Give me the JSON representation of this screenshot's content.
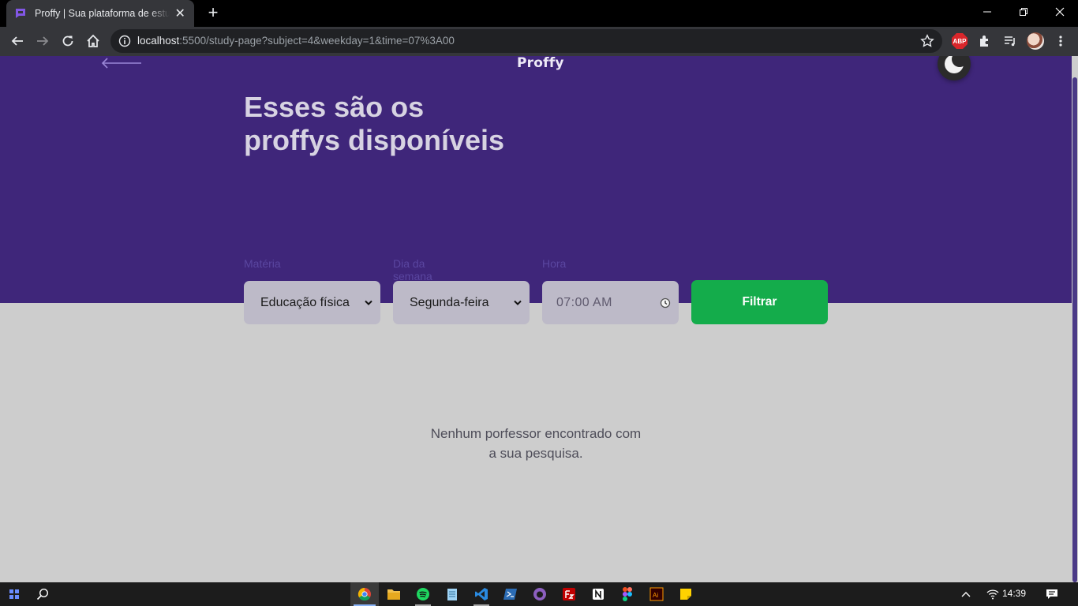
{
  "browser": {
    "tab_title": "Proffy | Sua plataforma de estudos online",
    "tab_close": "✕",
    "new_tab": "+",
    "url_host": "localhost",
    "url_rest": ":5500/study-page?subject=4&weekday=1&time=07%3A00",
    "extension_abp": "ABP"
  },
  "header": {
    "logo": "Proffy",
    "headline_line1": "Esses são os",
    "headline_line2": "proffys disponíveis"
  },
  "filters": {
    "subject_label": "Matéria",
    "subject_value": "Educação física",
    "weekday_label": "Dia da semana",
    "weekday_value": "Segunda-feira",
    "time_label": "Hora",
    "time_value": "07:00  AM",
    "submit_label": "Filtrar"
  },
  "results": {
    "empty_line1": "Nenhum porfessor encontrado com",
    "empty_line2": "a sua pesquisa."
  },
  "taskbar": {
    "clock": "14:39"
  },
  "colors": {
    "hero_bg": "#3f267a",
    "page_bg": "#cdcdcd",
    "accent_green": "#14ac4b",
    "control_bg": "#bdbac8"
  },
  "icons": [
    "back-arrow-icon",
    "moon-icon",
    "chevron-down-icon",
    "clock-icon",
    "search-icon",
    "star-icon",
    "puzzle-icon",
    "reading-list-icon"
  ]
}
